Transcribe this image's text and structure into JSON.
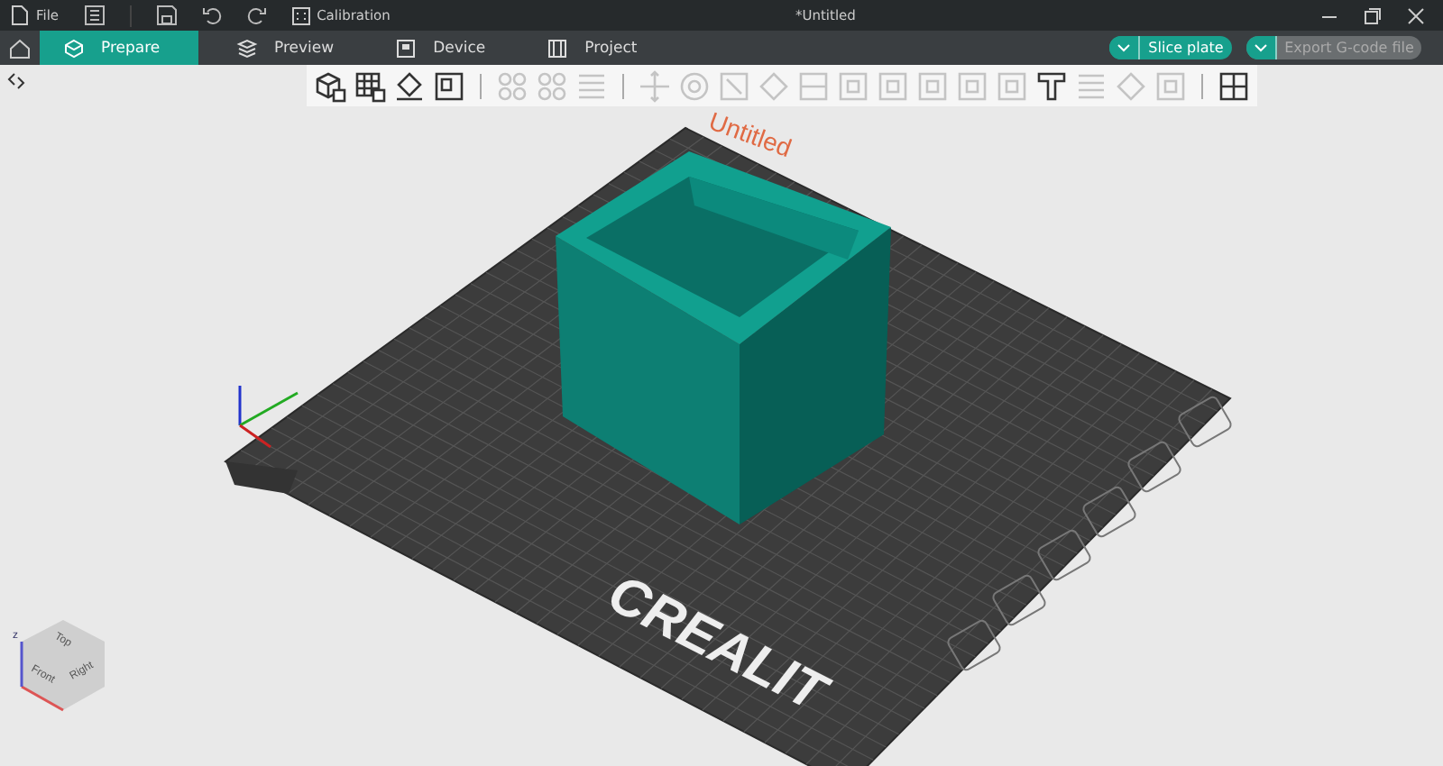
{
  "title_bar": {
    "file_menu": "File",
    "calibration": "Calibration",
    "document_title": "*Untitled"
  },
  "tabs": [
    {
      "label": "Prepare",
      "selected": true,
      "kind": "cube"
    },
    {
      "label": "Preview",
      "selected": false,
      "kind": "layers"
    },
    {
      "label": "Device",
      "selected": false,
      "kind": "device"
    },
    {
      "label": "Project",
      "selected": false,
      "kind": "project"
    }
  ],
  "actions": [
    {
      "label": "Slice plate",
      "disabled": false
    },
    {
      "label": "Export G-code file",
      "disabled": true
    }
  ],
  "toolbar": [
    {
      "kind": "add-cube",
      "disabled": false
    },
    {
      "kind": "add-grid",
      "disabled": false
    },
    {
      "kind": "orient",
      "disabled": false
    },
    {
      "kind": "arrange",
      "disabled": false
    },
    {
      "kind": "sep"
    },
    {
      "kind": "circles",
      "disabled": true
    },
    {
      "kind": "circles",
      "disabled": true
    },
    {
      "kind": "lines",
      "disabled": true
    },
    {
      "kind": "sep"
    },
    {
      "kind": "move",
      "disabled": true
    },
    {
      "kind": "rotate",
      "disabled": true
    },
    {
      "kind": "scale",
      "disabled": true
    },
    {
      "kind": "diamond",
      "disabled": true
    },
    {
      "kind": "cut",
      "disabled": true
    },
    {
      "kind": "square",
      "disabled": true
    },
    {
      "kind": "square",
      "disabled": true
    },
    {
      "kind": "square",
      "disabled": true
    },
    {
      "kind": "square",
      "disabled": true
    },
    {
      "kind": "square",
      "disabled": true
    },
    {
      "kind": "text",
      "disabled": false
    },
    {
      "kind": "lines",
      "disabled": true
    },
    {
      "kind": "diamond",
      "disabled": true
    },
    {
      "kind": "square",
      "disabled": true
    },
    {
      "kind": "sep"
    },
    {
      "kind": "puzzle",
      "disabled": false
    }
  ],
  "viewport": {
    "plate_label": "Untitled",
    "plate_logo": "CREALIT",
    "axis_label": "z",
    "view_cube": {
      "top": "Top",
      "front": "Front",
      "right": "Right"
    }
  }
}
